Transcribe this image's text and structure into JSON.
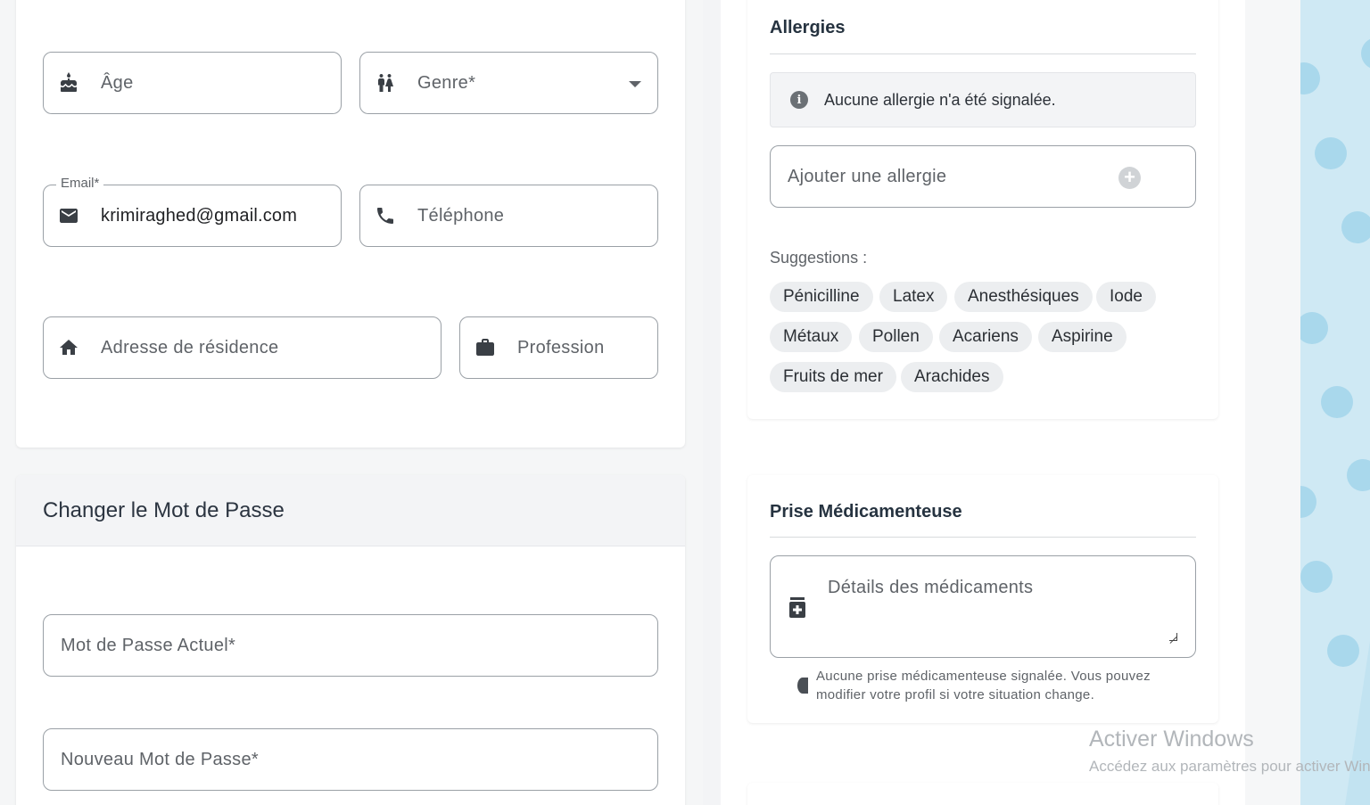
{
  "profile": {
    "age_placeholder": "Âge",
    "gender_placeholder": "Genre*",
    "email_label": "Email*",
    "email_value": "krimiraghed@gmail.com",
    "phone_placeholder": "Téléphone",
    "address_placeholder": "Adresse de résidence",
    "profession_placeholder": "Profession"
  },
  "password": {
    "title": "Changer le Mot de Passe",
    "current_placeholder": "Mot de Passe Actuel*",
    "new_placeholder": "Nouveau Mot de Passe*"
  },
  "allergies": {
    "title": "Allergies",
    "empty_message": "Aucune allergie n'a été signalée.",
    "add_placeholder": "Ajouter une allergie",
    "suggestions_label": "Suggestions :",
    "suggestions": [
      "Pénicilline",
      "Latex",
      "Anesthésiques",
      "Iode",
      "Métaux",
      "Pollen",
      "Acariens",
      "Aspirine",
      "Fruits de mer",
      "Arachides"
    ]
  },
  "medication": {
    "title": "Prise Médicamenteuse",
    "details_placeholder": "Détails des médicaments",
    "hint": "Aucune prise médicamenteuse signalée. Vous pouvez modifier votre profil si votre situation change."
  },
  "watermark": {
    "title": "Activer Windows",
    "subtitle": "Accédez aux paramètres pour activer Windows."
  },
  "icons": [
    "cake-icon",
    "people-icon",
    "mail-icon",
    "phone-icon",
    "home-icon",
    "briefcase-icon",
    "info-icon",
    "plus-circle-icon",
    "medication-icon",
    "chevron-down-icon"
  ]
}
